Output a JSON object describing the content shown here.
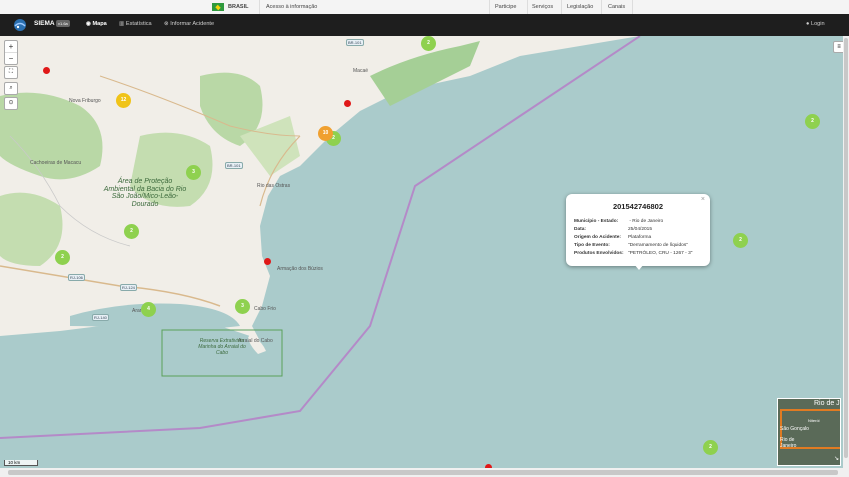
{
  "gov_bar": {
    "country": "BRASIL",
    "access_info": "Acesso à informação",
    "links": [
      "Participe",
      "Serviços",
      "Legislação",
      "Canais"
    ]
  },
  "navbar": {
    "brand": "SIEMA",
    "version": "v1.6a",
    "items": [
      "Mapa",
      "Estatística",
      "Informar Acidente"
    ],
    "login": "Login"
  },
  "map": {
    "places": [
      "Nova Friburgo",
      "Cachoeiras de Macacu",
      "Rio das Ostras",
      "Macaé",
      "Armação dos Búzios",
      "Cabo Frio",
      "Arraial do Cabo",
      "Araruama"
    ],
    "area_label": "Área de Proteção Ambiental da Bacia do Rio São João/Mico-Leão-Dourado",
    "reserve_label": "Reserva Extrativista Marinha do Arraial do Cabo",
    "roads": [
      "BR-101",
      "BR-101",
      "RJ-106",
      "RJ-124",
      "RJ-140"
    ],
    "clusters": [
      {
        "count": "2",
        "color": "green"
      },
      {
        "count": "12",
        "color": "yellow"
      },
      {
        "count": "3",
        "color": "green"
      },
      {
        "count": "2",
        "color": "green"
      },
      {
        "count": "2",
        "color": "green"
      },
      {
        "count": "4",
        "color": "green"
      },
      {
        "count": "3",
        "color": "green"
      },
      {
        "count": "2",
        "color": "green"
      },
      {
        "count": "2",
        "color": "green"
      },
      {
        "count": "2",
        "color": "green"
      },
      {
        "count": "2",
        "color": "green"
      },
      {
        "count": "10",
        "color": "orange"
      }
    ],
    "scale_label": "10 km",
    "minimap": {
      "labels": [
        "Rio de J",
        "São Gonçalo",
        "Rio de Janeiro",
        "Niterói"
      ]
    }
  },
  "popup": {
    "title": "201542746802",
    "close": "×",
    "fields": [
      {
        "label": "Município - Estado:",
        "value": " - Rio de Janeiro"
      },
      {
        "label": "Data:",
        "value": "25/04/2015"
      },
      {
        "label": "Origem do Acidente:",
        "value": "Plataforma"
      },
      {
        "label": "Tipo de Evento:",
        "value": "\"Derramamento de líquidos\""
      },
      {
        "label": "Produtos Envolvidos:",
        "value": "\"PETRÓLEO, CRU - 1267 - 3\""
      }
    ]
  },
  "colors": {
    "sea": "#aacbcb",
    "land": "#f1eee8",
    "forest": "#b9d8a6",
    "marker_red": "#e01818",
    "cluster_green": "#8fd14f",
    "cluster_yellow": "#f0c419",
    "boundary": "#b48ac8"
  }
}
